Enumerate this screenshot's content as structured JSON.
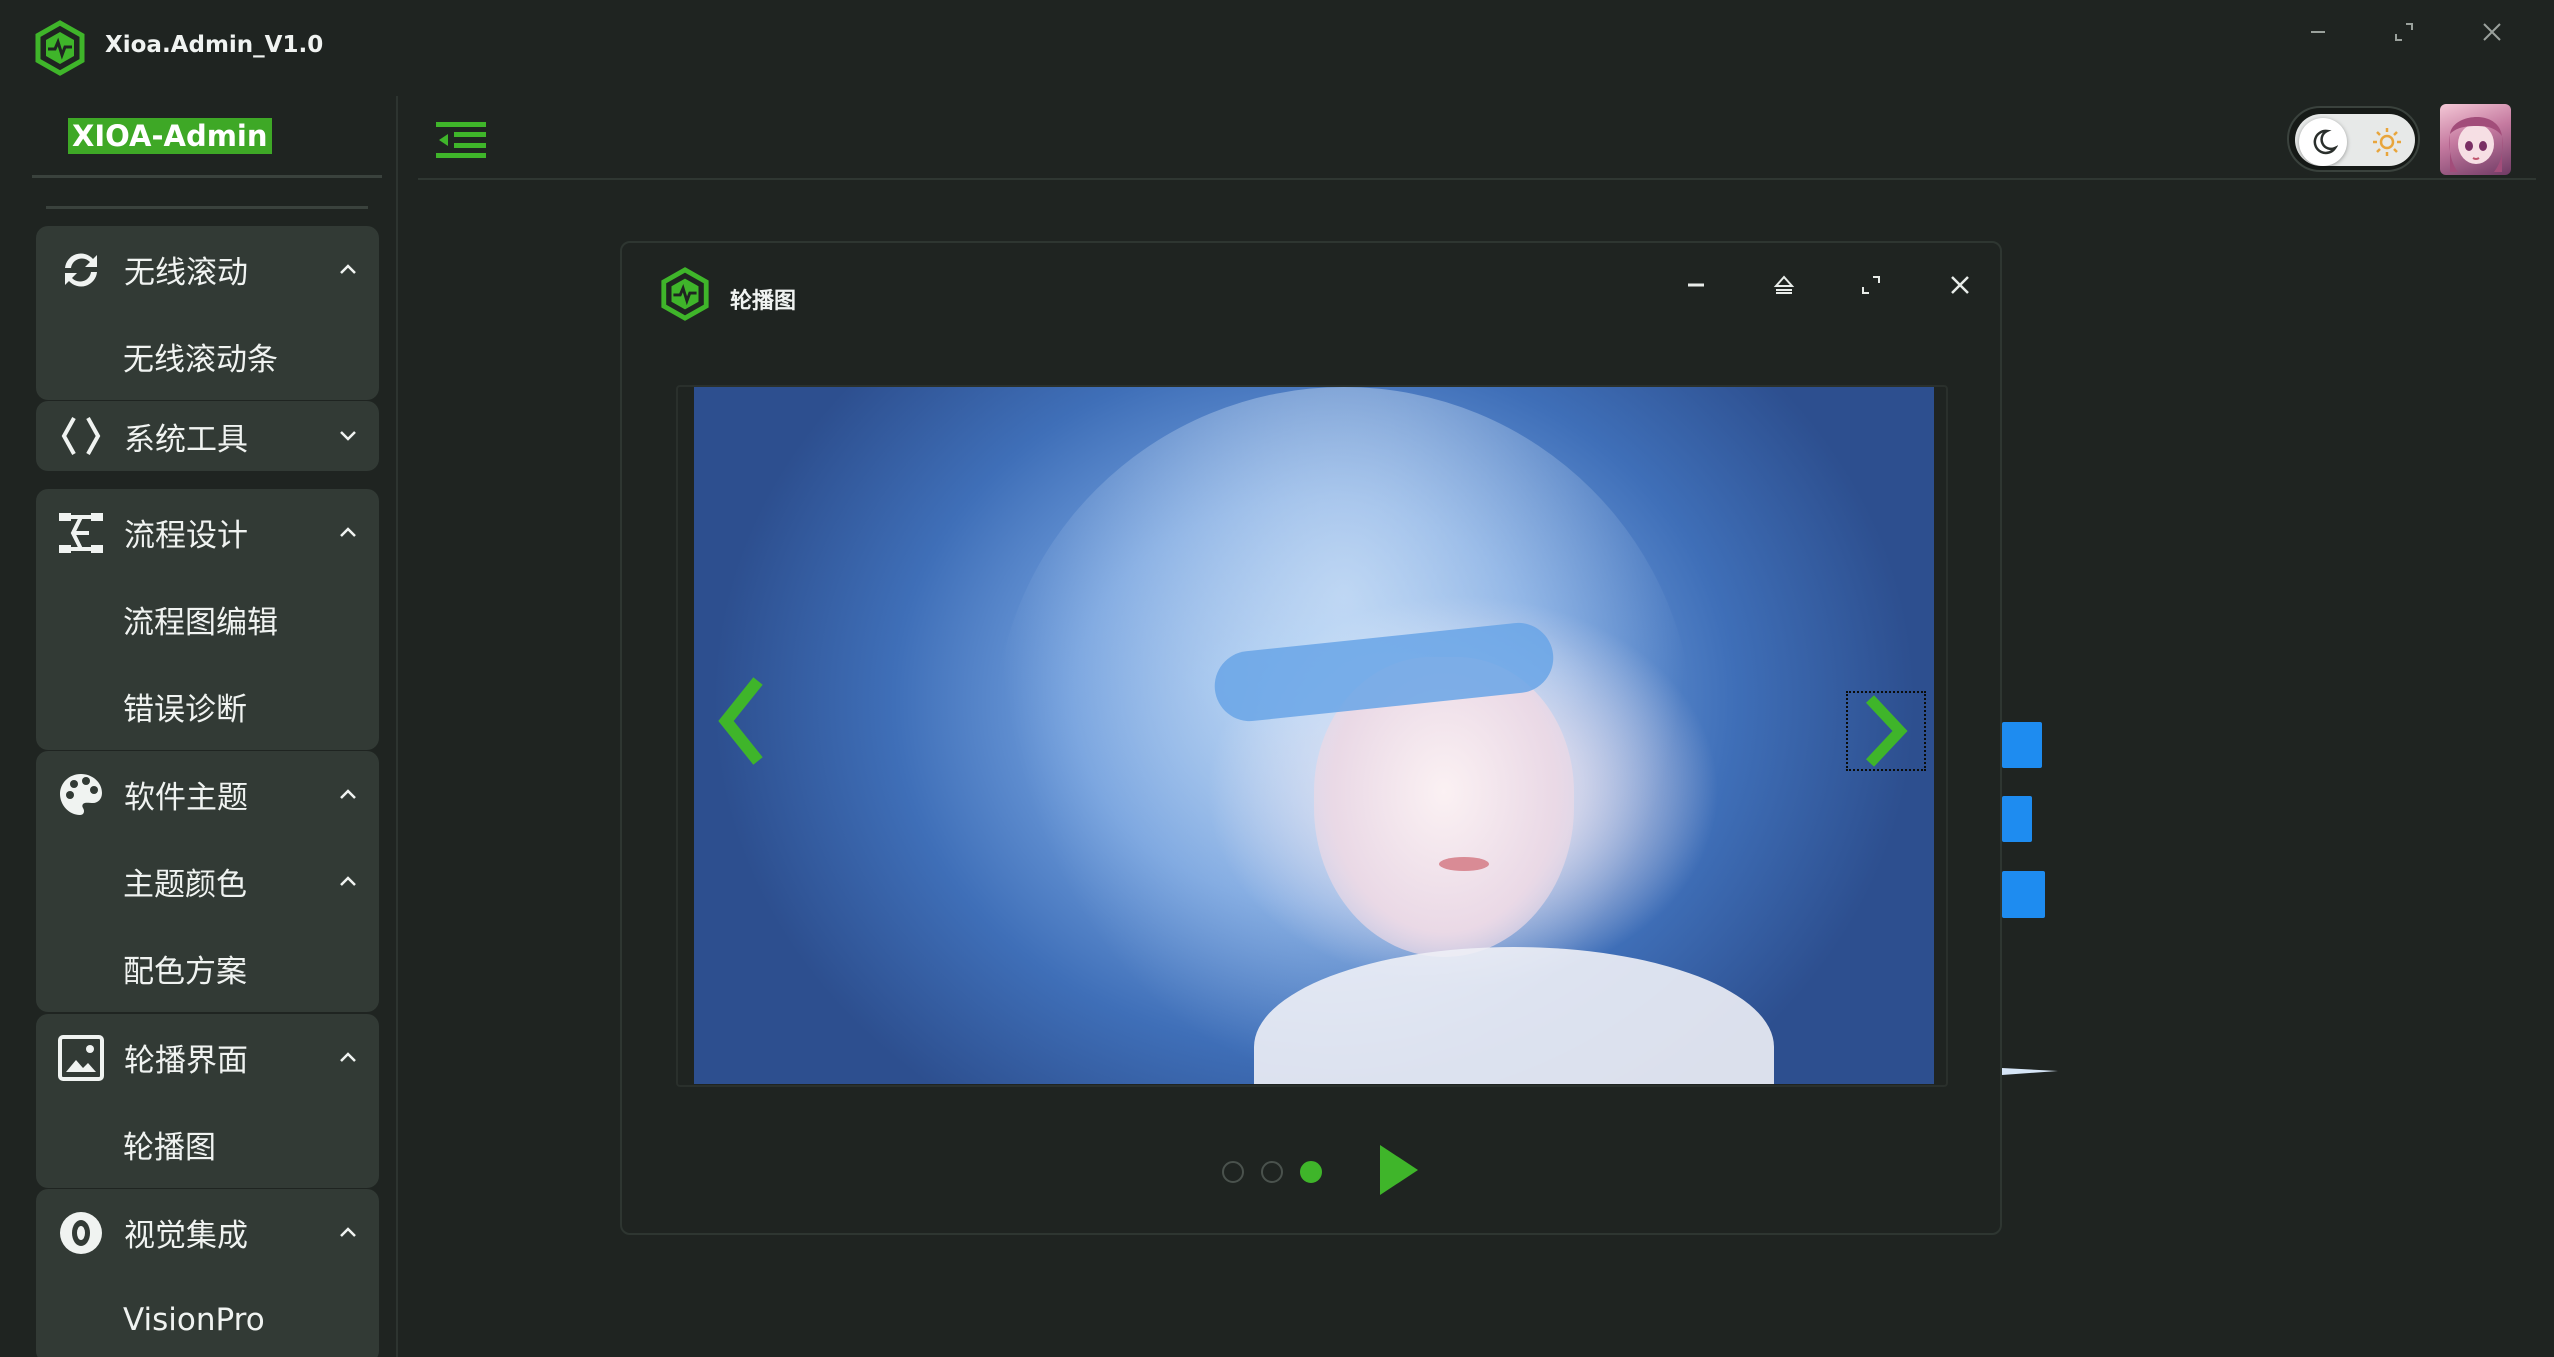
{
  "app": {
    "title": "Xioa.Admin_V1.0"
  },
  "colors": {
    "accent": "#3fb52a",
    "background": "#1f2421",
    "sidebar_group": "#323a35",
    "blue_mark": "#1e8cf0"
  },
  "sidebar": {
    "brand": "XIOA-Admin",
    "groups": [
      {
        "icon": "sync-icon",
        "label": "无线滚动",
        "expanded": true,
        "items": [
          {
            "label": "无线滚动条"
          }
        ]
      },
      {
        "icon": "code-brackets-icon",
        "label": "系统工具",
        "expanded": false,
        "items": []
      },
      {
        "icon": "flow-icon",
        "label": "流程设计",
        "expanded": true,
        "items": [
          {
            "label": "流程图编辑"
          },
          {
            "label": "错误诊断"
          }
        ]
      },
      {
        "icon": "palette-icon",
        "label": "软件主题",
        "expanded": true,
        "items": [
          {
            "label": "主题颜色",
            "has_children": true
          },
          {
            "label": "配色方案"
          }
        ]
      },
      {
        "icon": "image-icon",
        "label": "轮播界面",
        "expanded": true,
        "items": [
          {
            "label": "轮播图"
          }
        ]
      },
      {
        "icon": "eye-icon",
        "label": "视觉集成",
        "expanded": true,
        "items": [
          {
            "label": "VisionPro"
          }
        ]
      }
    ]
  },
  "topbar": {
    "theme": {
      "moon_icon": "moon-icon",
      "sun_icon": "sun-icon",
      "mode": "dark"
    }
  },
  "dialog": {
    "title": "轮播图",
    "carousel": {
      "slide_count": 3,
      "active_index": 2
    }
  }
}
